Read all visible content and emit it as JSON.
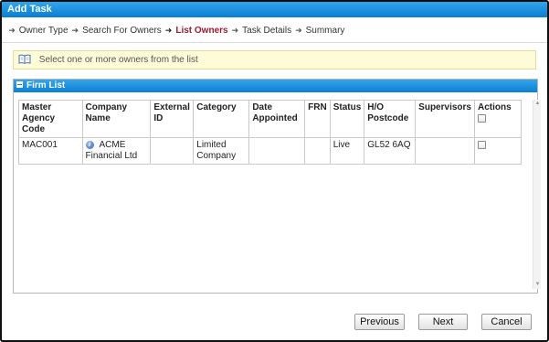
{
  "window": {
    "title": "Add Task"
  },
  "wizard": {
    "steps": [
      {
        "label": "Owner Type",
        "active": false
      },
      {
        "label": "Search For Owners",
        "active": false
      },
      {
        "label": "List Owners",
        "active": true
      },
      {
        "label": "Task Details",
        "active": false
      },
      {
        "label": "Summary",
        "active": false
      }
    ]
  },
  "notice": {
    "icon": "book-icon",
    "text": "Select one or more owners from the list"
  },
  "panel": {
    "title": "Firm List",
    "columns": [
      "Master Agency Code",
      "Company Name",
      "External ID",
      "Category",
      "Date Appointed",
      "FRN",
      "Status",
      "H/O Postcode",
      "Supervisors",
      "Actions"
    ],
    "rows": [
      {
        "master_agency_code": "MAC001",
        "company_name": "ACME Financial Ltd",
        "external_id": "",
        "category": "Limited Company",
        "date_appointed": "",
        "frn": "",
        "status": "Live",
        "ho_postcode": "GL52 6AQ",
        "supervisors": "",
        "selected": false
      }
    ],
    "select_all_checked": false
  },
  "buttons": {
    "previous": "Previous",
    "next": "Next",
    "cancel": "Cancel"
  },
  "colors": {
    "titlebar": "#0a7fd0",
    "active_step": "#9b1b30",
    "notice_bg": "#fefbd8"
  }
}
